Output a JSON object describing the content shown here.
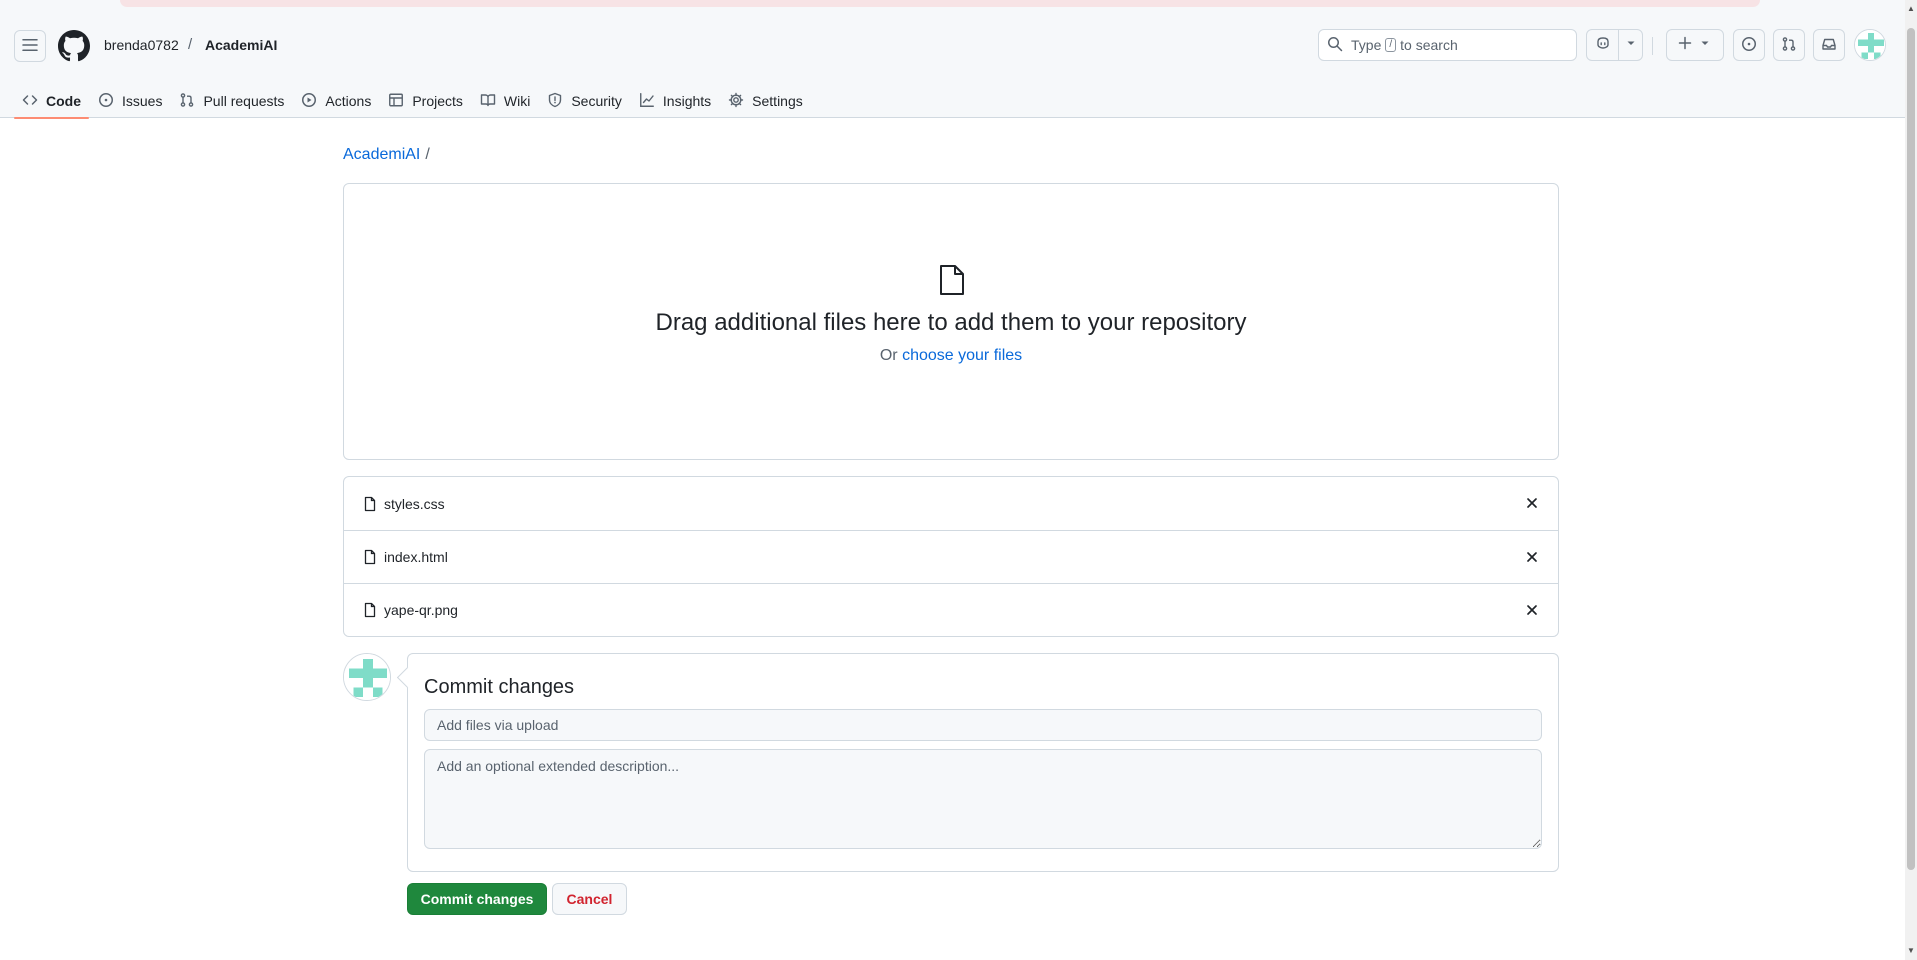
{
  "header": {
    "owner": "brenda0782",
    "separator": "/",
    "repo": "AcademiAI",
    "search": {
      "prefix": "Type",
      "key": "/",
      "suffix": "to search"
    }
  },
  "tabs": [
    {
      "label": "Code",
      "icon": "code-icon",
      "active": true
    },
    {
      "label": "Issues",
      "icon": "issue-opened-icon"
    },
    {
      "label": "Pull requests",
      "icon": "git-pull-request-icon"
    },
    {
      "label": "Actions",
      "icon": "play-icon"
    },
    {
      "label": "Projects",
      "icon": "table-icon"
    },
    {
      "label": "Wiki",
      "icon": "book-icon"
    },
    {
      "label": "Security",
      "icon": "shield-icon"
    },
    {
      "label": "Insights",
      "icon": "graph-icon"
    },
    {
      "label": "Settings",
      "icon": "gear-icon"
    }
  ],
  "breadcrumb": {
    "repo": "AcademiAI",
    "separator": "/"
  },
  "dropzone": {
    "title": "Drag additional files here to add them to your repository",
    "or": "Or",
    "choose_link": "choose your files"
  },
  "files": [
    {
      "name": "styles.css"
    },
    {
      "name": "index.html"
    },
    {
      "name": "yape-qr.png"
    }
  ],
  "commit": {
    "title": "Commit changes",
    "message_placeholder": "Add files via upload",
    "description_placeholder": "Add an optional extended description...",
    "commit_button": "Commit changes",
    "cancel_button": "Cancel"
  },
  "colors": {
    "primary_button": "#1f883d",
    "link": "#0969da",
    "active_tab_underline": "#fd8c73",
    "cancel_text": "#d1242f",
    "avatar_identicon": "#7fdcc8"
  }
}
